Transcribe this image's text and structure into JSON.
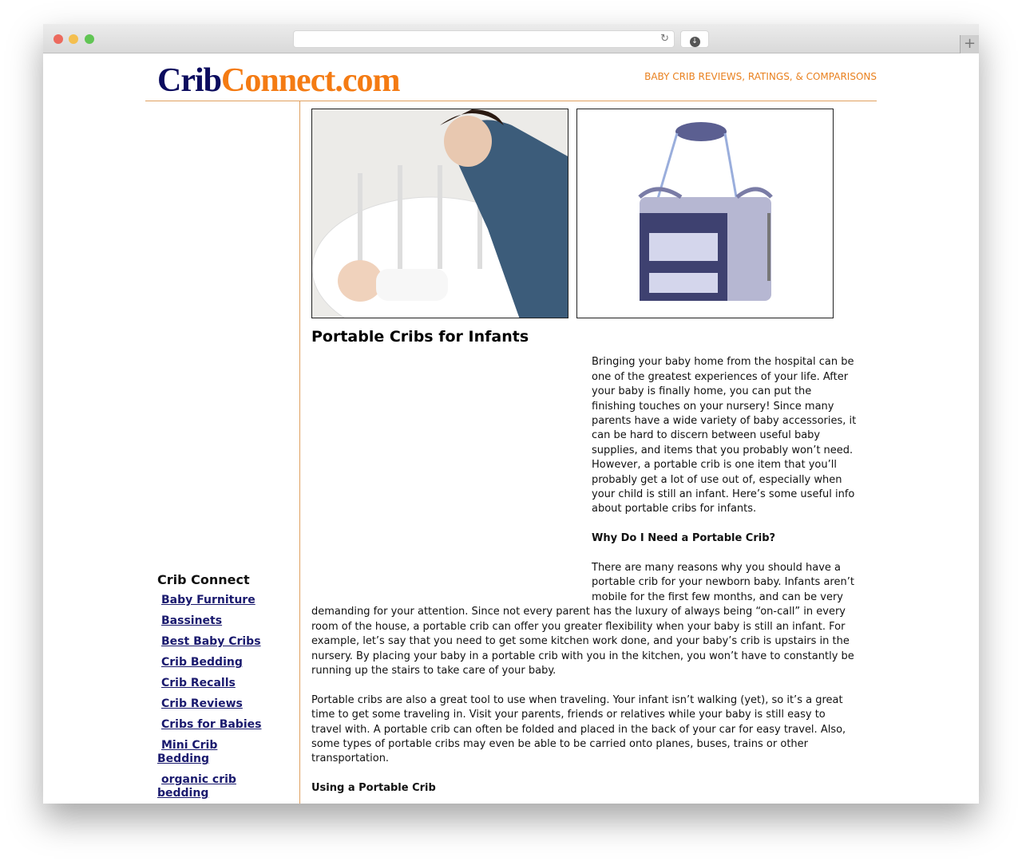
{
  "browser": {
    "url": "",
    "colors": {
      "close": "#ec6a5e",
      "minimize": "#f4bf4f",
      "maximize": "#61c554"
    }
  },
  "header": {
    "logo_part1": "Crib",
    "logo_part2": "Connect.com",
    "tagline": "BABY CRIB REVIEWS, RATINGS, & COMPARISONS"
  },
  "sidebar": {
    "title": "Crib Connect",
    "links": [
      "Baby Furniture",
      "Bassinets",
      "Best Baby Cribs",
      "Crib Bedding",
      "Crib Recalls",
      "Crib Reviews",
      "Cribs for Babies",
      "Mini Crib Bedding",
      "organic crib bedding"
    ]
  },
  "main": {
    "title": "Portable Cribs for Infants",
    "paragraphs": [
      "Bringing your baby home from the hospital can be one of the greatest experiences of your life. After your baby is finally home, you can put the finishing touches on your nursery! Since many parents have a wide variety of baby accessories, it can be hard to discern between useful baby supplies, and items that you probably won’t need. However, a portable crib is one item that you’ll probably get a lot of use out of, especially when your child is still an infant. Here’s some useful info about portable cribs for infants.",
      "Why Do I Need a Portable Crib?",
      "There are many reasons why you should have a portable crib for your newborn baby. Infants aren’t mobile for the first few months, and can be very demanding for your attention. Since not every parent has the luxury of always being “on-call” in every room of the house, a portable crib can offer you greater flexibility when your baby is still an infant. For example, let’s say that you need to get some kitchen work done, and your baby’s crib is upstairs in the nursery. By placing your baby in a portable crib with you in the kitchen, you won’t have to constantly be running up the stairs to take care of your baby.",
      "Portable cribs are also a great tool to use when traveling. Your infant isn’t walking (yet), so it’s a great time to get some traveling in. Visit your parents, friends or relatives while your baby is still easy to travel with. A portable crib can often be folded and placed in the back of your car for easy travel. Also, some types of portable cribs may even be able to be carried onto planes, buses, trains or other transportation.",
      "Using a Portable Crib"
    ]
  }
}
